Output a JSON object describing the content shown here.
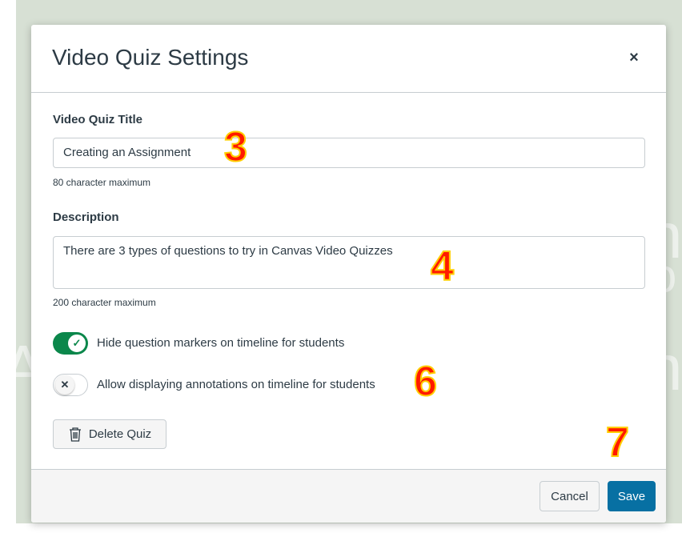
{
  "background": {
    "letters": [
      "A",
      "n",
      "n",
      "o"
    ]
  },
  "modal": {
    "title": "Video Quiz Settings",
    "close_symbol": "×",
    "quiz_title": {
      "label": "Video Quiz Title",
      "value": "Creating an Assignment",
      "hint": "80 character maximum"
    },
    "description": {
      "label": "Description",
      "value": "There are 3 types of questions to try in Canvas Video Quizzes",
      "hint": "200 character maximum"
    },
    "toggles": [
      {
        "label": "Hide question markers on timeline for students",
        "checked": true
      },
      {
        "label": "Allow displaying annotations on timeline for students",
        "checked": false
      }
    ],
    "delete_button": {
      "label": "Delete Quiz",
      "icon": "trash-icon"
    },
    "footer": {
      "cancel_label": "Cancel",
      "save_label": "Save"
    }
  },
  "step_markers": [
    "3",
    "4",
    "6",
    "7"
  ],
  "colors": {
    "primary": "#0770a3",
    "toggle_on": "#0b874b",
    "marker": "#ff1a00",
    "marker_outline": "#ffce00"
  }
}
